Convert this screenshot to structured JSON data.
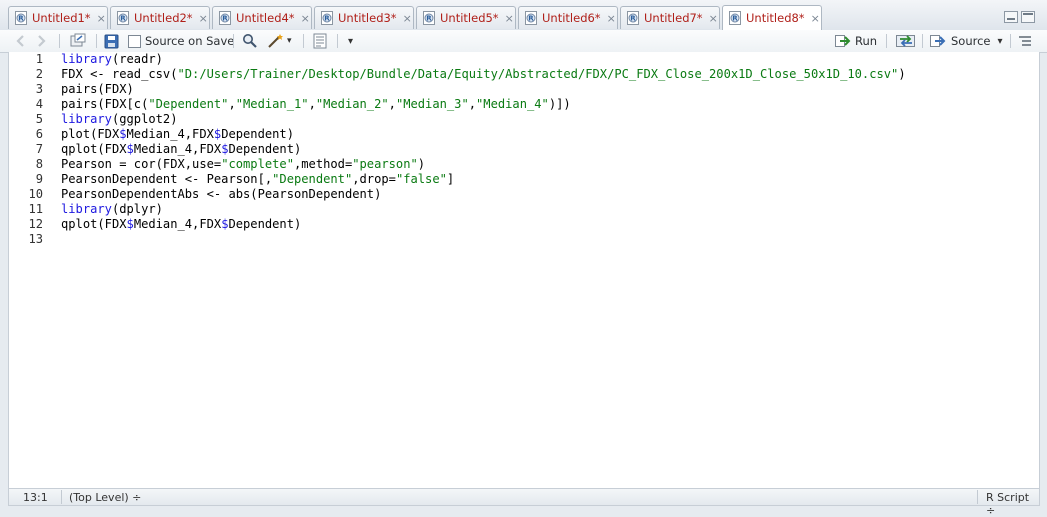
{
  "tabs": [
    {
      "label": "Untitled1*",
      "active": false
    },
    {
      "label": "Untitled2*",
      "active": false
    },
    {
      "label": "Untitled4*",
      "active": false
    },
    {
      "label": "Untitled3*",
      "active": false
    },
    {
      "label": "Untitled5*",
      "active": false
    },
    {
      "label": "Untitled6*",
      "active": false
    },
    {
      "label": "Untitled7*",
      "active": false
    },
    {
      "label": "Untitled8*",
      "active": true
    }
  ],
  "tab_close": "×",
  "toolbar": {
    "source_on_save": "Source on Save",
    "run": "Run",
    "source": "Source",
    "dropdown_arrow": "▾"
  },
  "editor": {
    "line_numbers": [
      "1",
      "2",
      "3",
      "4",
      "5",
      "6",
      "7",
      "8",
      "9",
      "10",
      "11",
      "12",
      "13"
    ],
    "lines": [
      [
        {
          "t": "library",
          "c": "kw"
        },
        {
          "t": "(readr)"
        }
      ],
      [
        {
          "t": "FDX <- read_csv("
        },
        {
          "t": "\"D:/Users/Trainer/Desktop/Bundle/Data/Equity/Abstracted/FDX/PC_FDX_Close_200x1D_Close_50x1D_10.csv\"",
          "c": "str"
        },
        {
          "t": ")"
        }
      ],
      [
        {
          "t": "pairs(FDX)"
        }
      ],
      [
        {
          "t": "pairs(FDX[c("
        },
        {
          "t": "\"Dependent\"",
          "c": "str"
        },
        {
          "t": ","
        },
        {
          "t": "\"Median_1\"",
          "c": "str"
        },
        {
          "t": ","
        },
        {
          "t": "\"Median_2\"",
          "c": "str"
        },
        {
          "t": ","
        },
        {
          "t": "\"Median_3\"",
          "c": "str"
        },
        {
          "t": ","
        },
        {
          "t": "\"Median_4\"",
          "c": "str"
        },
        {
          "t": ")])"
        }
      ],
      [
        {
          "t": "library",
          "c": "kw"
        },
        {
          "t": "(ggplot2)"
        }
      ],
      [
        {
          "t": "plot(FDX"
        },
        {
          "t": "$",
          "c": "kw"
        },
        {
          "t": "Median_4,FDX"
        },
        {
          "t": "$",
          "c": "kw"
        },
        {
          "t": "Dependent)"
        }
      ],
      [
        {
          "t": "qplot(FDX"
        },
        {
          "t": "$",
          "c": "kw"
        },
        {
          "t": "Median_4,FDX"
        },
        {
          "t": "$",
          "c": "kw"
        },
        {
          "t": "Dependent)"
        }
      ],
      [
        {
          "t": "Pearson = cor(FDX,use="
        },
        {
          "t": "\"complete\"",
          "c": "str"
        },
        {
          "t": ",method="
        },
        {
          "t": "\"pearson\"",
          "c": "str"
        },
        {
          "t": ")"
        }
      ],
      [
        {
          "t": "PearsonDependent <- Pearson[,"
        },
        {
          "t": "\"Dependent\"",
          "c": "str"
        },
        {
          "t": ",drop="
        },
        {
          "t": "\"false\"",
          "c": "str"
        },
        {
          "t": "]"
        }
      ],
      [
        {
          "t": "PearsonDependentAbs <- abs(PearsonDependent)"
        }
      ],
      [
        {
          "t": "library",
          "c": "kw"
        },
        {
          "t": "(dplyr)"
        }
      ],
      [
        {
          "t": "qplot(FDX"
        },
        {
          "t": "$",
          "c": "kw"
        },
        {
          "t": "Median_4,FDX"
        },
        {
          "t": "$",
          "c": "kw"
        },
        {
          "t": "Dependent)"
        }
      ],
      []
    ]
  },
  "status": {
    "position": "13:1",
    "scope": "(Top Level) ÷",
    "filetype": "R Script ÷"
  },
  "colors": {
    "keyword": "#1d18e0",
    "string": "#0a7a12",
    "tab_text": "#b0201a"
  }
}
